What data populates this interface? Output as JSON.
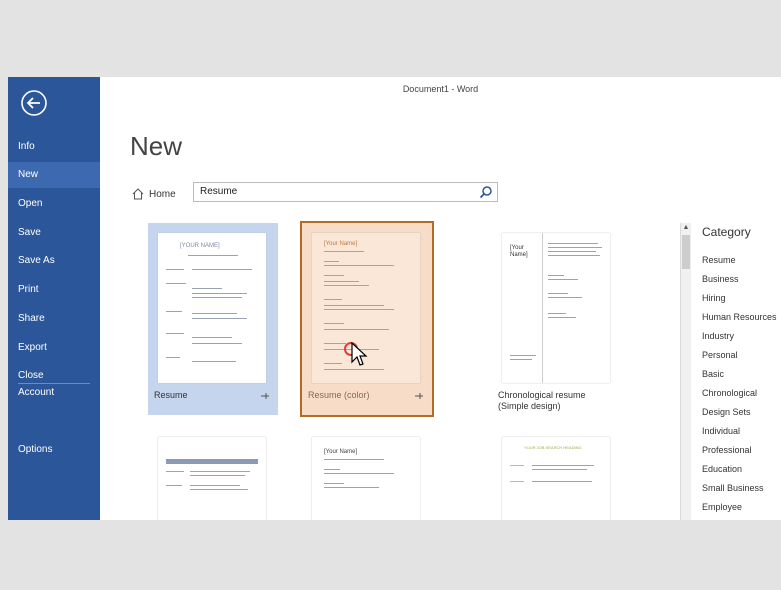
{
  "window": {
    "title": "Document1 - Word"
  },
  "nav": {
    "back_icon": "arrow-left-circle-icon",
    "items": [
      {
        "label": "Info"
      },
      {
        "label": "New",
        "active": true
      },
      {
        "label": "Open"
      },
      {
        "label": "Save"
      },
      {
        "label": "Save As"
      },
      {
        "label": "Print"
      },
      {
        "label": "Share"
      },
      {
        "label": "Export"
      },
      {
        "label": "Close"
      },
      {
        "label": "Account"
      },
      {
        "label": "Options"
      }
    ]
  },
  "main": {
    "heading": "New",
    "home_label": "Home",
    "search": {
      "value": "Resume",
      "icon": "search-icon"
    }
  },
  "templates": [
    {
      "caption_line1": "Resume",
      "caption_line2": "",
      "state": "selected"
    },
    {
      "caption_line1": "Resume (color)",
      "caption_line2": "",
      "state": "hover"
    },
    {
      "caption_line1": "Chronological resume",
      "caption_line2": "(Simple design)",
      "state": "normal"
    },
    {
      "caption_line1": "",
      "caption_line2": "",
      "state": "normal"
    },
    {
      "caption_line1": "",
      "caption_line2": "",
      "state": "normal"
    },
    {
      "caption_line1": "",
      "caption_line2": "",
      "state": "normal"
    }
  ],
  "thumbs": {
    "t1_name": "[YOUR NAME]",
    "t2_name": "[Your Name]",
    "t3_name_1": "[Your",
    "t3_name_2": "Name]",
    "t5_name": "[Your Name]",
    "t6_name": "YOUR JOB SEARCH HEADING"
  },
  "category": {
    "title": "Category",
    "items": [
      "Resume",
      "Business",
      "Hiring",
      "Human Resources",
      "Industry",
      "Personal",
      "Basic",
      "Chronological",
      "Design Sets",
      "Individual",
      "Professional",
      "Education",
      "Small Business",
      "Employee"
    ]
  },
  "colors": {
    "backstage": "#2b579a",
    "accent_selected": "#c5d5ee",
    "accent_hover_border": "#b36b22"
  }
}
